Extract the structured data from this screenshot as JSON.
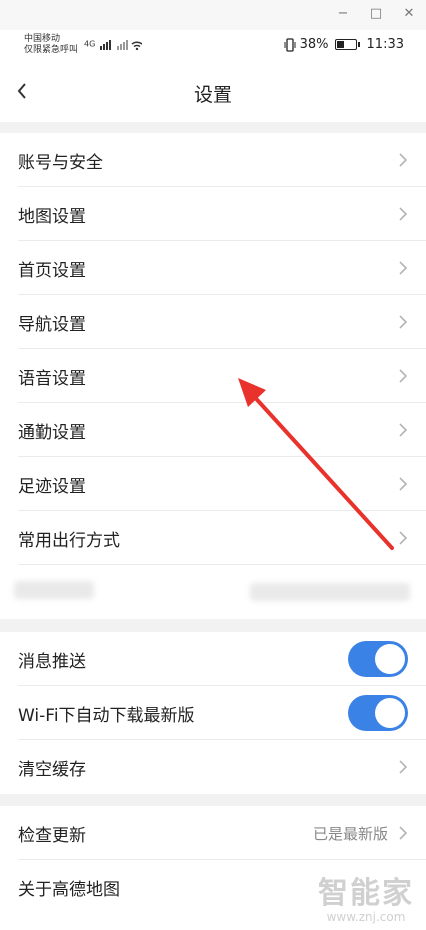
{
  "window": {
    "minimize": "−",
    "maximize": "□",
    "close": "✕"
  },
  "status_bar": {
    "carrier_line1": "中国移动",
    "carrier_line2": "仅限紧急呼叫",
    "signal": "4G",
    "battery_percent": "38%",
    "time": "11:33"
  },
  "header": {
    "title": "设置",
    "back_icon": "chevron-left-icon"
  },
  "group1": [
    {
      "label": "账号与安全"
    },
    {
      "label": "地图设置"
    },
    {
      "label": "首页设置"
    },
    {
      "label": "导航设置"
    },
    {
      "label": "语音设置"
    },
    {
      "label": "通勤设置"
    },
    {
      "label": "足迹设置"
    },
    {
      "label": "常用出行方式"
    }
  ],
  "group2": [
    {
      "label": "消息推送",
      "toggle": true
    },
    {
      "label": "Wi-Fi下自动下载最新版",
      "toggle": true
    },
    {
      "label": "清空缓存"
    }
  ],
  "group3": [
    {
      "label": "检查更新",
      "value": "已是最新版"
    },
    {
      "label": "关于高德地图"
    }
  ],
  "watermark": {
    "main": "智能家",
    "sub": "www.znj.com"
  },
  "colors": {
    "toggle_on": "#3b82e6",
    "arrow": "#e8322b",
    "section_gap": "#f2f2f2"
  }
}
